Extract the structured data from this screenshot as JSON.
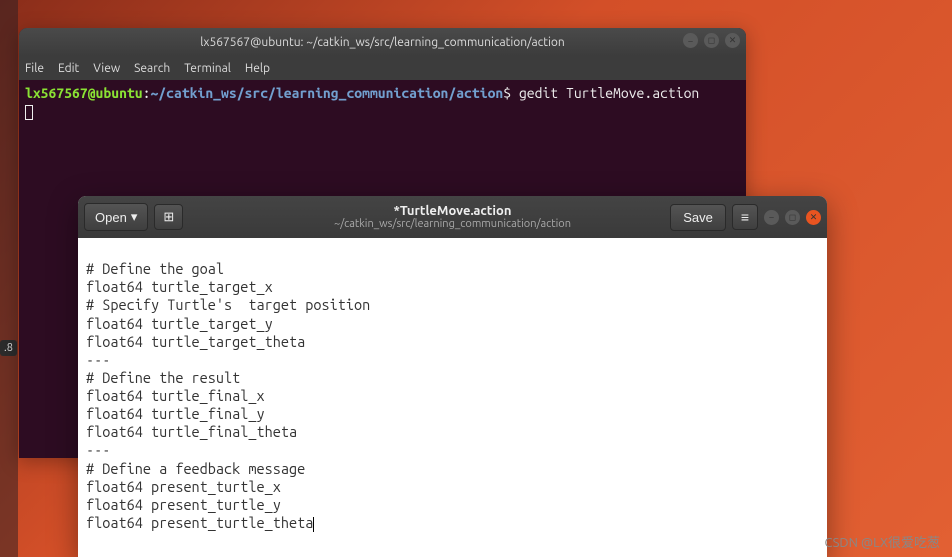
{
  "launcher": {
    "badge": ".8"
  },
  "terminal": {
    "title": "lx567567@ubuntu: ~/catkin_ws/src/learning_communication/action",
    "menu": {
      "file": "File",
      "edit": "Edit",
      "view": "View",
      "search": "Search",
      "terminal": "Terminal",
      "help": "Help"
    },
    "prompt": {
      "user": "lx567567@ubuntu",
      "sep1": ":",
      "path": "~/catkin_ws/src/learning_communication/action",
      "sep2": "$",
      "command": " gedit TurtleMove.action"
    }
  },
  "gedit": {
    "open_label": "Open",
    "title": "*TurtleMove.action",
    "subtitle": "~/catkin_ws/src/learning_communication/action",
    "save_label": "Save",
    "lines": {
      "l0": "# Define the goal",
      "l1": "float64 turtle_target_x",
      "l2": "# Specify Turtle's  target position",
      "l3": "float64 turtle_target_y",
      "l4": "float64 turtle_target_theta",
      "l5": "---",
      "l6": "# Define the result",
      "l7": "float64 turtle_final_x",
      "l8": "float64 turtle_final_y",
      "l9": "float64 turtle_final_theta",
      "l10": "---",
      "l11": "# Define a feedback message",
      "l12": "float64 present_turtle_x",
      "l13": "float64 present_turtle_y",
      "l14": "float64 present_turtle_theta"
    }
  },
  "watermark": "CSDN @LX很爱吃葱"
}
